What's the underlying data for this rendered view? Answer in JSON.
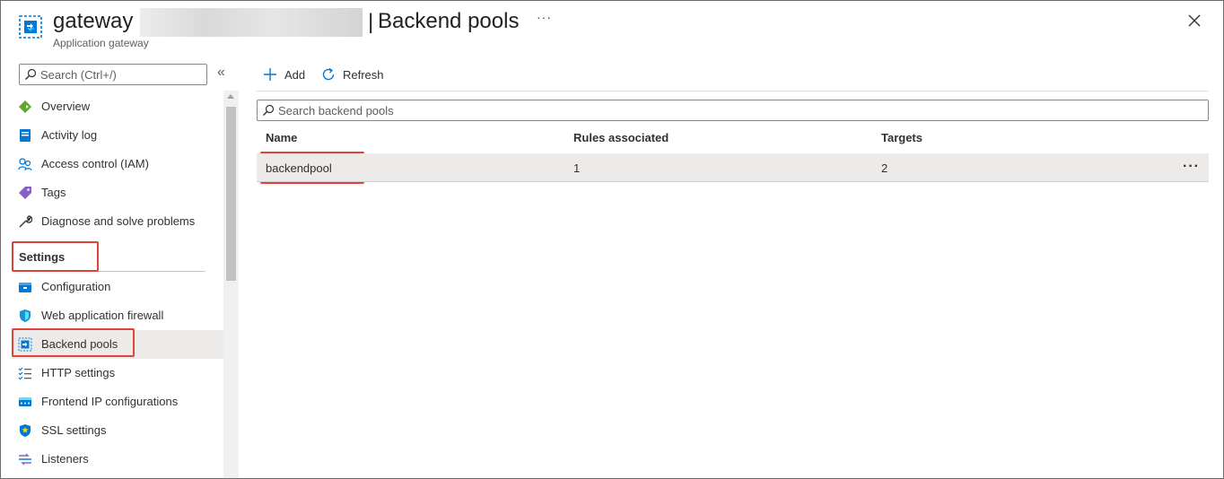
{
  "header": {
    "resource_name": "gateway",
    "separator": "|",
    "page_title": "Backend pools",
    "resource_type": "Application gateway",
    "more": "···"
  },
  "sidebar": {
    "search_placeholder": "Search (Ctrl+/)",
    "collapse": "«",
    "items": [
      {
        "label": "Overview",
        "icon": "overview-icon"
      },
      {
        "label": "Activity log",
        "icon": "activity-log-icon"
      },
      {
        "label": "Access control (IAM)",
        "icon": "access-control-icon"
      },
      {
        "label": "Tags",
        "icon": "tag-icon"
      },
      {
        "label": "Diagnose and solve problems",
        "icon": "wrench-icon"
      }
    ],
    "section_title": "Settings",
    "settings_items": [
      {
        "label": "Configuration",
        "icon": "configuration-icon"
      },
      {
        "label": "Web application firewall",
        "icon": "shield-icon"
      },
      {
        "label": "Backend pools",
        "icon": "backend-pools-icon",
        "active": true
      },
      {
        "label": "HTTP settings",
        "icon": "http-settings-icon"
      },
      {
        "label": "Frontend IP configurations",
        "icon": "frontend-ip-icon"
      },
      {
        "label": "SSL settings",
        "icon": "ssl-shield-icon"
      },
      {
        "label": "Listeners",
        "icon": "listeners-icon"
      }
    ]
  },
  "toolbar": {
    "add_label": "Add",
    "refresh_label": "Refresh"
  },
  "main": {
    "search_placeholder": "Search backend pools",
    "columns": [
      "Name",
      "Rules associated",
      "Targets"
    ],
    "rows": [
      {
        "name": "backendpool",
        "rules_associated": "1",
        "targets": "2",
        "more": "···"
      }
    ]
  },
  "colors": {
    "accent": "#0078d4",
    "highlight_box": "#e0433a",
    "selected_row": "#edebe9"
  }
}
